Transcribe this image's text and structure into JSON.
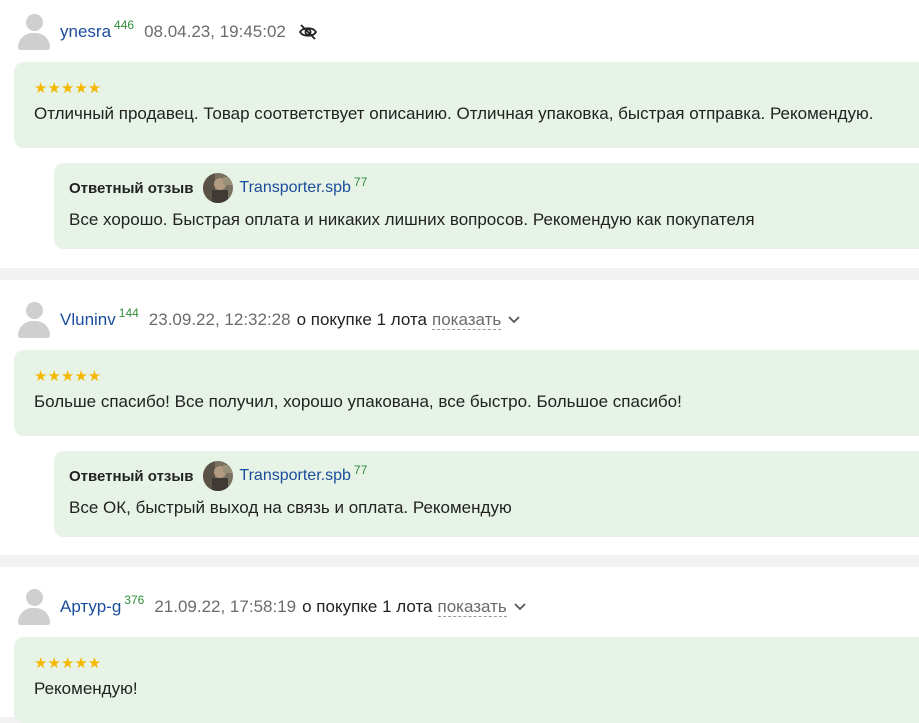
{
  "reviews": [
    {
      "username": "ynesra",
      "rating_count": "446",
      "date": "08.04.23, 19:45:02",
      "stars": "★★★★★",
      "text": "Отличный продавец. Товар соответствует описанию. Отличная упаковка, быстрая отправка. Рекомендую.",
      "reply": {
        "title": "Ответный отзыв",
        "seller": "Transporter.spb",
        "seller_rating": "77",
        "text": "Все хорошо. Быстрая оплата и никаких лишних вопросов. Рекомендую как покупателя"
      }
    },
    {
      "username": "Vluninv",
      "rating_count": "144",
      "date": "23.09.22, 12:32:28",
      "purchase_text": "о покупке 1 лота",
      "show_label": "показать",
      "stars": "★★★★★",
      "text": "Больше спасибо! Все получил, хорошо упакована, все быстро. Большое спасибо!",
      "reply": {
        "title": "Ответный отзыв",
        "seller": "Transporter.spb",
        "seller_rating": "77",
        "text": "Все ОК, быстрый выход на связь и оплата. Рекомендую"
      }
    },
    {
      "username": "Артур-g",
      "rating_count": "376",
      "date": "21.09.22, 17:58:19",
      "purchase_text": "о покупке 1 лота",
      "show_label": "показать",
      "stars": "★★★★★",
      "text": "Рекомендую!"
    }
  ],
  "colors": {
    "bubble": "#e7f3e6",
    "username": "#1a4d9c",
    "rating": "#2f8f3a",
    "stars": "#f5b800"
  },
  "icons": {
    "hidden": "eye-off-icon",
    "expand": "chevron-down-icon",
    "user": "user-avatar-icon"
  }
}
